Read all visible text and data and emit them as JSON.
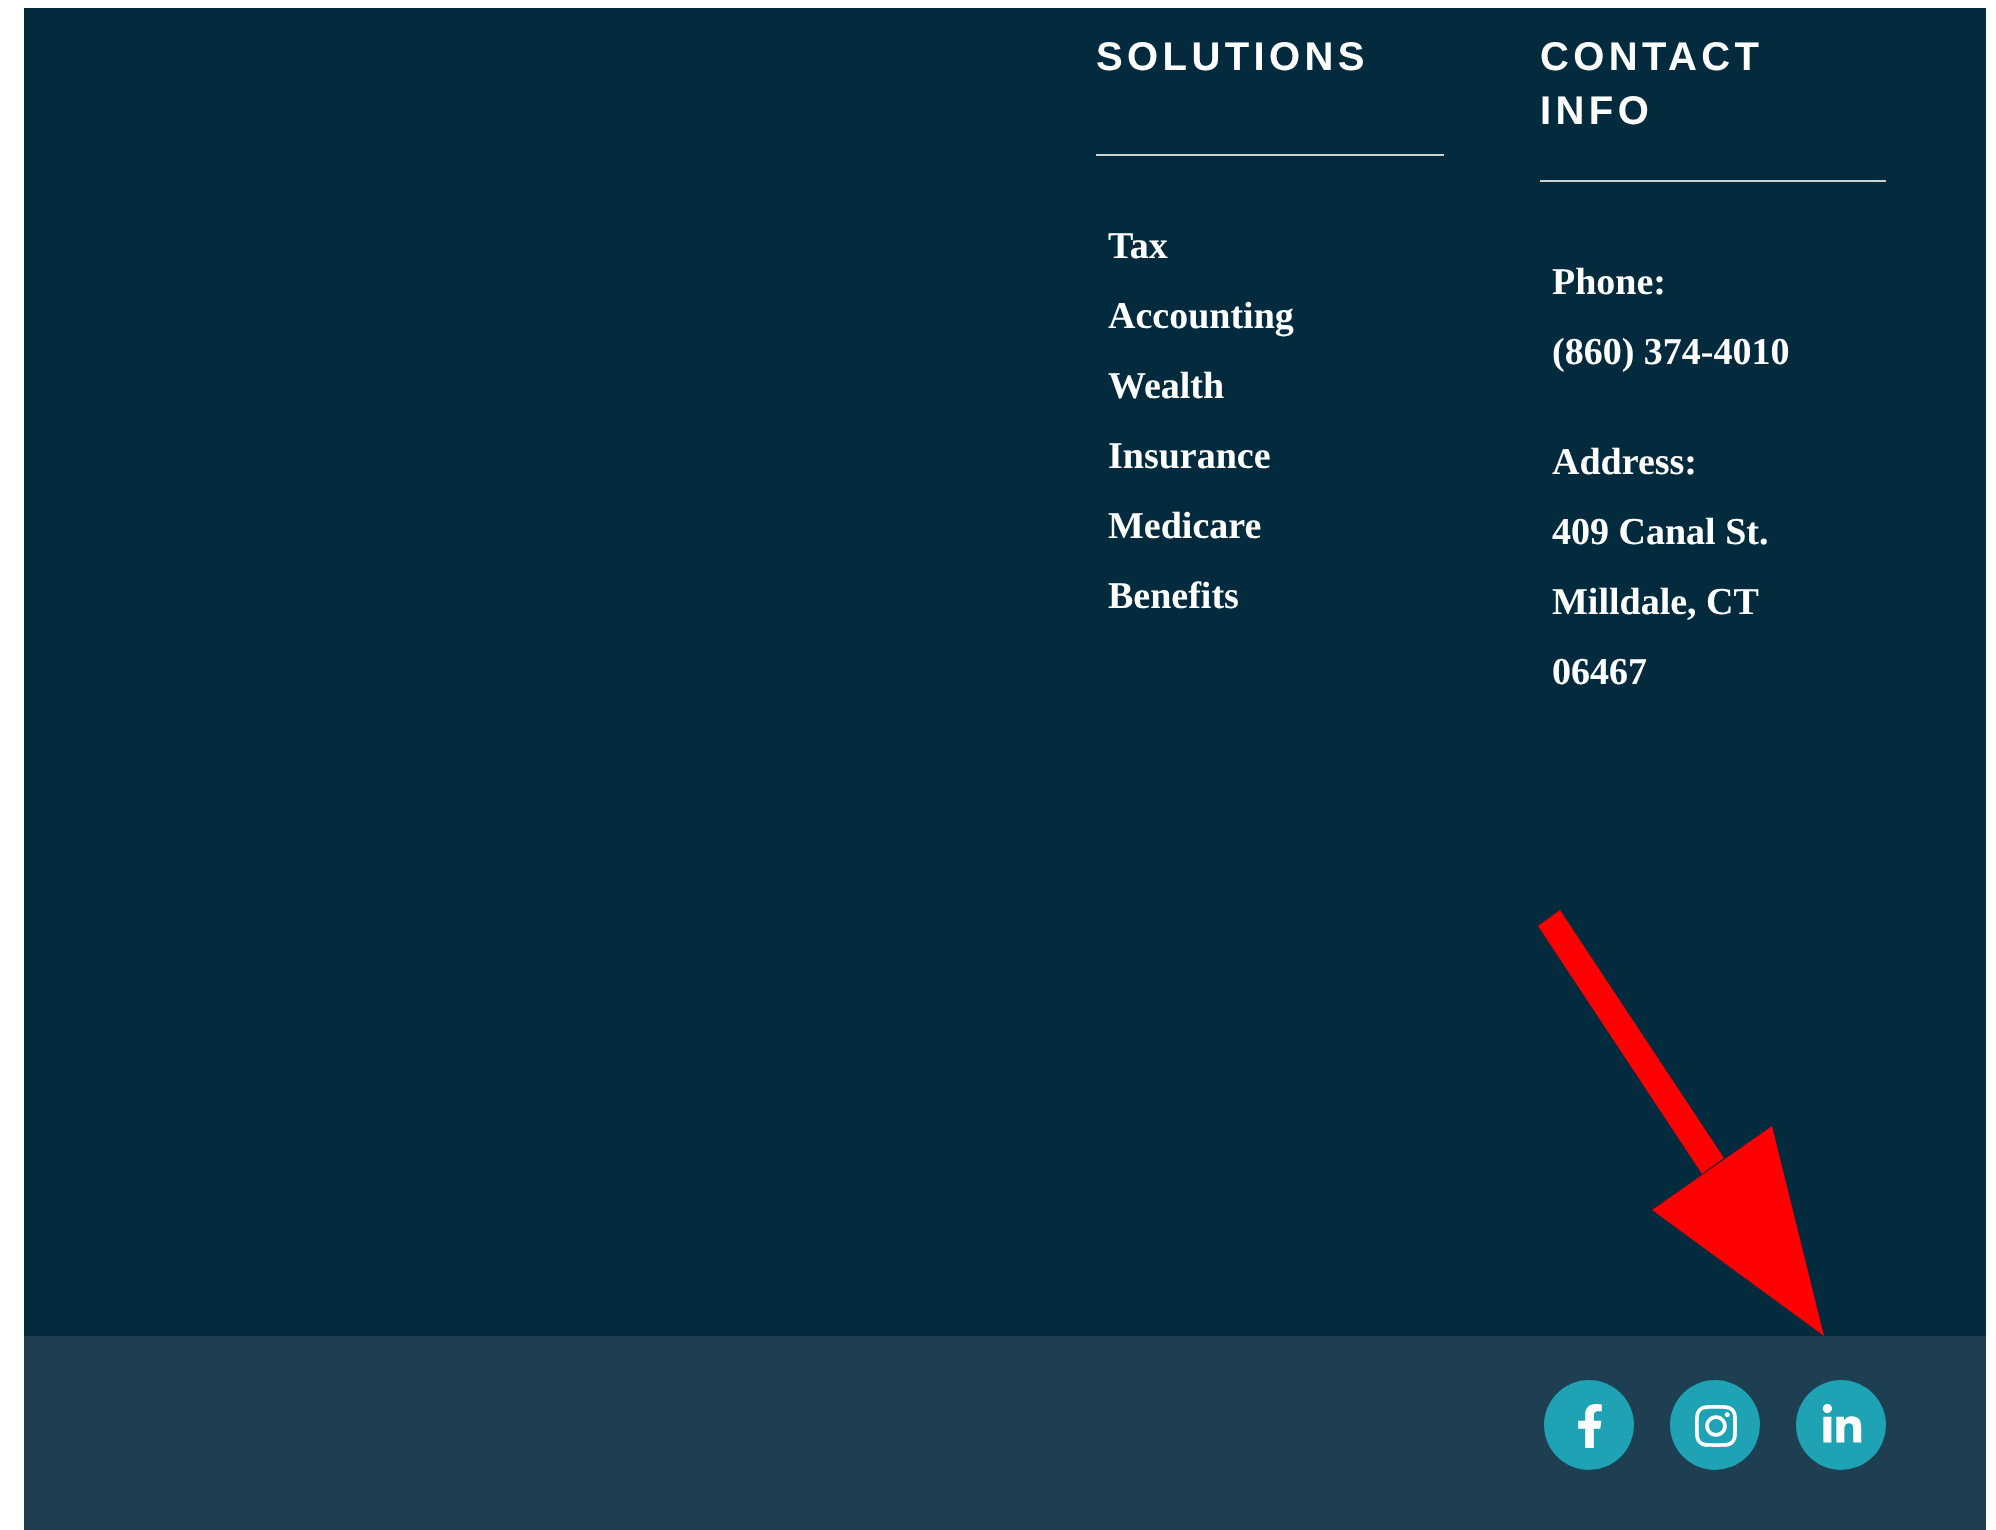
{
  "solutions": {
    "heading": "SOLUTIONS",
    "items": [
      "Tax",
      "Accounting",
      "Wealth",
      "Insurance",
      "Medicare",
      "Benefits"
    ]
  },
  "contact": {
    "heading": "CONTACT INFO",
    "groups": [
      {
        "label": "Phone:",
        "lines": [
          "(860) 374-4010"
        ]
      },
      {
        "label": "Address:",
        "lines": [
          "409 Canal St.",
          "Milldale, CT",
          "06467"
        ]
      }
    ]
  },
  "social": [
    {
      "kind": "facebook"
    },
    {
      "kind": "instagram"
    },
    {
      "kind": "linkedin"
    }
  ]
}
